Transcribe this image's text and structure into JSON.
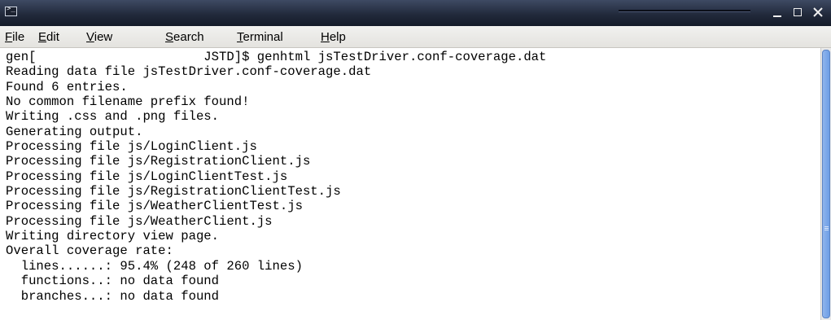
{
  "window": {
    "icon": "terminal-icon",
    "controls": [
      "minimize-icon",
      "maximize-icon",
      "close-icon"
    ]
  },
  "menubar": {
    "items": [
      {
        "label_mnemonic": "F",
        "label_rest": "ile"
      },
      {
        "label_mnemonic": "E",
        "label_rest": "dit"
      },
      {
        "label_mnemonic": "V",
        "label_rest": "iew"
      },
      {
        "label_mnemonic": "S",
        "label_rest": "earch"
      },
      {
        "label_mnemonic": "T",
        "label_rest": "erminal"
      },
      {
        "label_mnemonic": "H",
        "label_rest": "elp"
      }
    ]
  },
  "terminal": {
    "lines": [
      "gen[                      JSTD]$ genhtml jsTestDriver.conf-coverage.dat",
      "Reading data file jsTestDriver.conf-coverage.dat",
      "Found 6 entries.",
      "No common filename prefix found!",
      "Writing .css and .png files.",
      "Generating output.",
      "Processing file js/LoginClient.js",
      "Processing file js/RegistrationClient.js",
      "Processing file js/LoginClientTest.js",
      "Processing file js/RegistrationClientTest.js",
      "Processing file js/WeatherClientTest.js",
      "Processing file js/WeatherClient.js",
      "Writing directory view page.",
      "Overall coverage rate:",
      "  lines......: 95.4% (248 of 260 lines)",
      "  functions..: no data found",
      "  branches...: no data found"
    ]
  },
  "colors": {
    "titlebar": "#222a3c",
    "menubar": "#e8e7e3",
    "terminal_bg": "#ffffff",
    "terminal_fg": "#000000",
    "scroll_thumb": "#7fa9ea"
  }
}
